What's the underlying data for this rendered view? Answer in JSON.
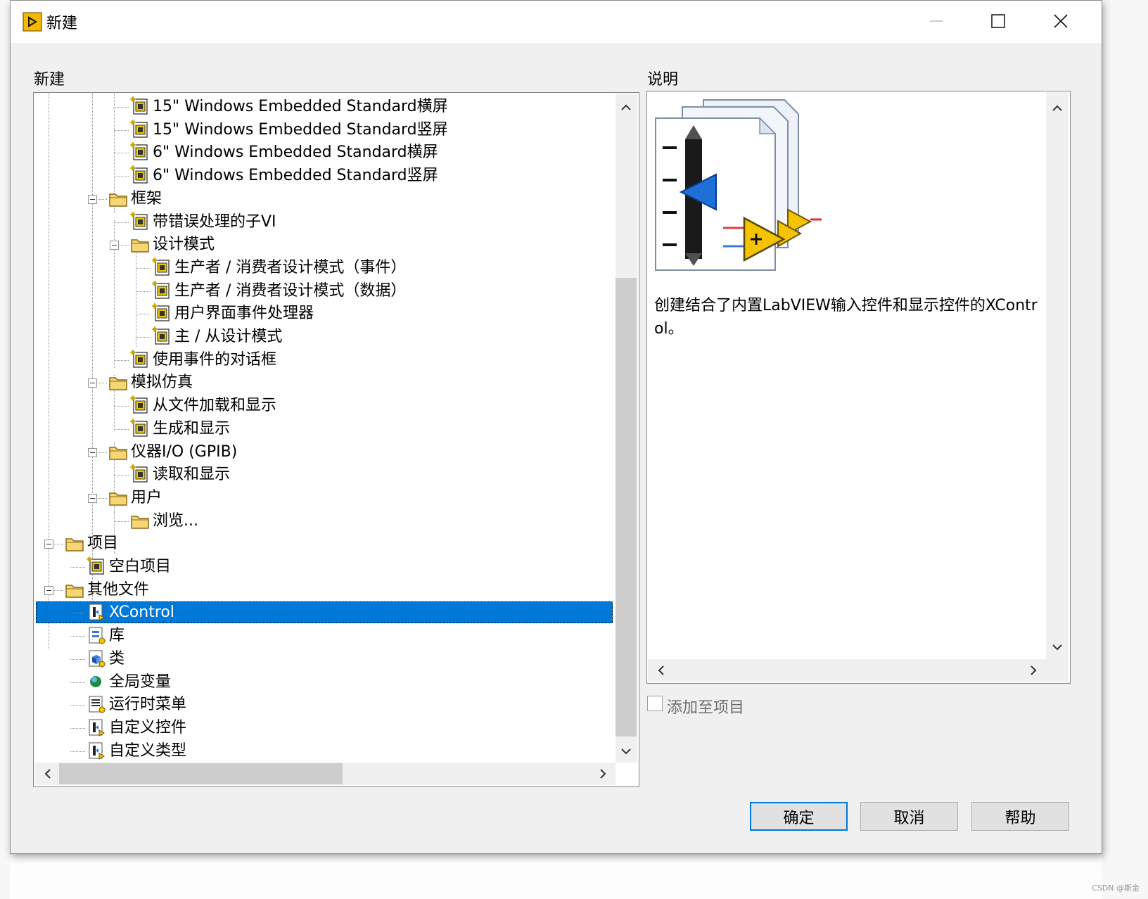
{
  "window": {
    "title": "新建"
  },
  "left_panel": {
    "label": "新建"
  },
  "right_panel": {
    "label": "说明"
  },
  "tree": [
    {
      "label": "15\" Windows Embedded Standard横屏",
      "icon": "vi-template-icon",
      "level": 3
    },
    {
      "label": "15\" Windows Embedded Standard竖屏",
      "icon": "vi-template-icon",
      "level": 3
    },
    {
      "label": "6\" Windows Embedded Standard横屏",
      "icon": "vi-template-icon",
      "level": 3
    },
    {
      "label": "6\" Windows Embedded Standard竖屏",
      "icon": "vi-template-icon",
      "level": 3
    },
    {
      "label": "框架",
      "icon": "folder-icon",
      "level": 2,
      "expanded": true
    },
    {
      "label": "带错误处理的子VI",
      "icon": "vi-template-icon",
      "level": 3
    },
    {
      "label": "设计模式",
      "icon": "folder-icon",
      "level": 3,
      "expanded": true
    },
    {
      "label": "生产者 / 消费者设计模式（事件）",
      "icon": "vi-template-icon",
      "level": 4
    },
    {
      "label": "生产者 / 消费者设计模式（数据）",
      "icon": "vi-template-icon",
      "level": 4
    },
    {
      "label": "用户界面事件处理器",
      "icon": "vi-template-icon",
      "level": 4
    },
    {
      "label": "主 / 从设计模式",
      "icon": "vi-template-icon",
      "level": 4
    },
    {
      "label": "使用事件的对话框",
      "icon": "vi-template-icon",
      "level": 3
    },
    {
      "label": "模拟仿真",
      "icon": "folder-icon",
      "level": 2,
      "expanded": true
    },
    {
      "label": "从文件加载和显示",
      "icon": "vi-template-icon",
      "level": 3
    },
    {
      "label": "生成和显示",
      "icon": "vi-template-icon",
      "level": 3
    },
    {
      "label": "仪器I/O (GPIB)",
      "icon": "folder-icon",
      "level": 2,
      "expanded": true
    },
    {
      "label": "读取和显示",
      "icon": "vi-template-icon",
      "level": 3
    },
    {
      "label": "用户",
      "icon": "folder-icon",
      "level": 2,
      "expanded": true
    },
    {
      "label": "浏览...",
      "icon": "folder-icon",
      "level": 3
    },
    {
      "label": "项目",
      "icon": "folder-icon",
      "level": 0,
      "expanded": true
    },
    {
      "label": "空白项目",
      "icon": "project-icon",
      "level": 1
    },
    {
      "label": "其他文件",
      "icon": "folder-icon",
      "level": 0,
      "expanded": true
    },
    {
      "label": "XControl",
      "icon": "xcontrol-icon",
      "level": 1,
      "selected": true
    },
    {
      "label": "库",
      "icon": "library-icon",
      "level": 1
    },
    {
      "label": "类",
      "icon": "class-icon",
      "level": 1
    },
    {
      "label": "全局变量",
      "icon": "globe-icon",
      "level": 1
    },
    {
      "label": "运行时菜单",
      "icon": "menu-file-icon",
      "level": 1
    },
    {
      "label": "自定义控件",
      "icon": "control-file-icon",
      "level": 1
    },
    {
      "label": "自定义类型",
      "icon": "control-file-icon",
      "level": 1
    }
  ],
  "description": {
    "text": "创建结合了内置LabVIEW输入控件和显示控件的XControl。",
    "image": "xcontrol-preview-icon"
  },
  "add_to_project": {
    "label": "添加至项目",
    "checked": false,
    "enabled": false
  },
  "buttons": {
    "ok": "确定",
    "cancel": "取消",
    "help": "帮助"
  },
  "watermark": "CSDN @斯金",
  "colors": {
    "selection": "#0078d7",
    "window_bg": "#f0f0f0",
    "default_button_border": "#0078d7"
  }
}
